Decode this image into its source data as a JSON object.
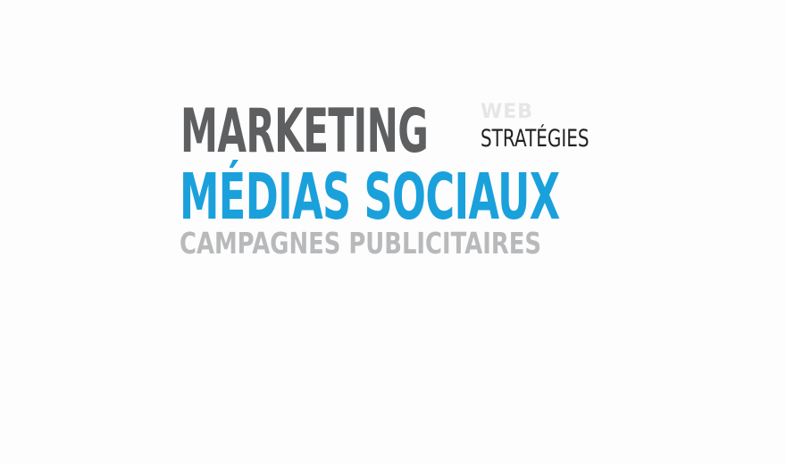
{
  "logo": {
    "marketing": "MARKETING",
    "web": "WEB",
    "strategies": "STRATÉGIES",
    "medias_sociaux": "MÉDIAS SOCIAUX",
    "campagnes": "CAMPAGNES PUBLICITAIRES"
  },
  "colors": {
    "background": "#fdfdfd",
    "dark_gray": "#5e5f61",
    "light_gray": "#e6e6e6",
    "near_black": "#222222",
    "blue": "#1aa1dc",
    "mid_gray": "#b8b9bb"
  }
}
